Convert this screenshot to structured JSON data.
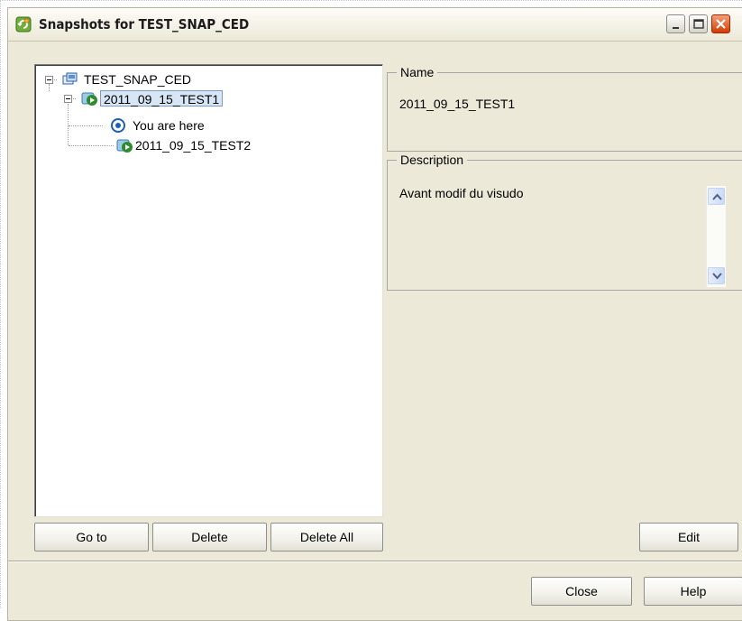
{
  "window": {
    "title": "Snapshots for TEST_SNAP_CED",
    "icon": "vm-snapshot-icon"
  },
  "tree": {
    "root": {
      "label": "TEST_SNAP_CED",
      "icon": "virtual-machine-icon",
      "expanded": true
    },
    "snapshot1": {
      "label": "2011_09_15_TEST1",
      "icon": "snapshot-icon",
      "expanded": true,
      "selected": true
    },
    "current": {
      "label": "You are here",
      "icon": "you-are-here-icon"
    },
    "snapshot2": {
      "label": "2011_09_15_TEST2",
      "icon": "snapshot-icon"
    }
  },
  "details": {
    "name_legend": "Name",
    "name_value": "2011_09_15_TEST1",
    "description_legend": "Description",
    "description_value": "Avant modif du visudo"
  },
  "buttons": {
    "goto": "Go to",
    "delete": "Delete",
    "delete_all": "Delete All",
    "edit": "Edit",
    "close": "Close",
    "help": "Help"
  },
  "colors": {
    "window_bg": "#ece9d8",
    "selection_bg": "#d7e6f4",
    "selection_border": "#7d9ec0"
  }
}
